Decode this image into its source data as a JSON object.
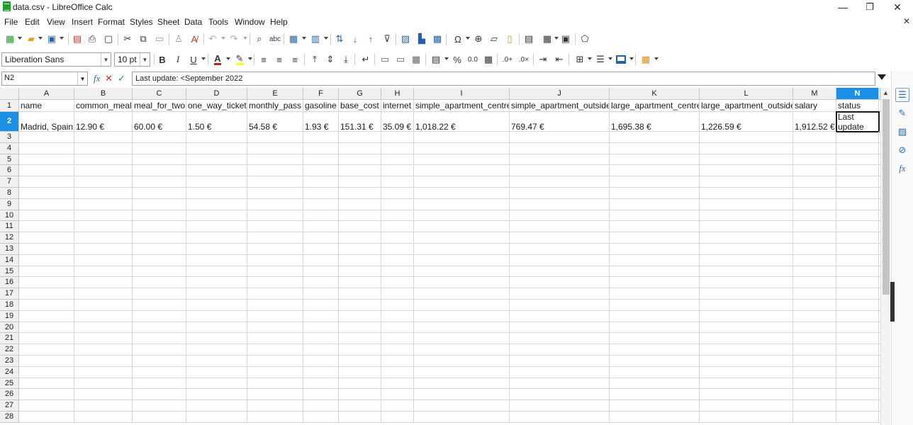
{
  "window": {
    "title": "data.csv - LibreOffice Calc",
    "minimize": "—",
    "restore": "❐",
    "close": "✕",
    "doc_close": "✕"
  },
  "menu": [
    "File",
    "Edit",
    "View",
    "Insert",
    "Format",
    "Styles",
    "Sheet",
    "Data",
    "Tools",
    "Window",
    "Help"
  ],
  "toolbar2": {
    "font_name": "Liberation Sans",
    "font_size": "10 pt",
    "bold": "B",
    "italic": "I",
    "underline": "U",
    "percent": "%",
    "decimal": "0.0"
  },
  "formula_bar": {
    "name_box": "N2",
    "fx": "fx",
    "cancel": "✕",
    "accept": "✓",
    "content": "Last update: <September 2022"
  },
  "columns": [
    "A",
    "B",
    "C",
    "D",
    "E",
    "F",
    "G",
    "H",
    "I",
    "J",
    "K",
    "L",
    "M",
    "N"
  ],
  "selected_column": "N",
  "selected_row": "2",
  "row_numbers": [
    "1",
    "2",
    "3",
    "4",
    "5",
    "6",
    "7",
    "8",
    "9",
    "10",
    "11",
    "12",
    "13",
    "14",
    "15",
    "16",
    "17",
    "18",
    "19",
    "20",
    "21",
    "22",
    "23",
    "24",
    "25",
    "26",
    "27",
    "28"
  ],
  "rows": [
    [
      "name",
      "common_meal",
      "meal_for_two",
      "one_way_ticket",
      "monthly_pass",
      "gasoline",
      "base_cost",
      "internet",
      "simple_apartment_centre",
      "simple_apartment_outside",
      "large_apartment_centre",
      "large_apartment_outside",
      "salary",
      "status"
    ],
    [
      "Madrid, Spain",
      "12.90 €",
      "60.00 €",
      "1.50 €",
      "54.58 €",
      "1.93 €",
      "151.31 €",
      "35.09 €",
      "1,018.22 €",
      "769.47 €",
      "1,695.38 €",
      "1,226.59 €",
      "1,912.52 €",
      "Last update: <September 2022"
    ]
  ],
  "n2_display": [
    "Last update",
    "2022"
  ],
  "colors": {
    "selection": "#1b8fe3",
    "header_bg": "#f0f0f0",
    "grid_line": "#d6d6d6"
  }
}
